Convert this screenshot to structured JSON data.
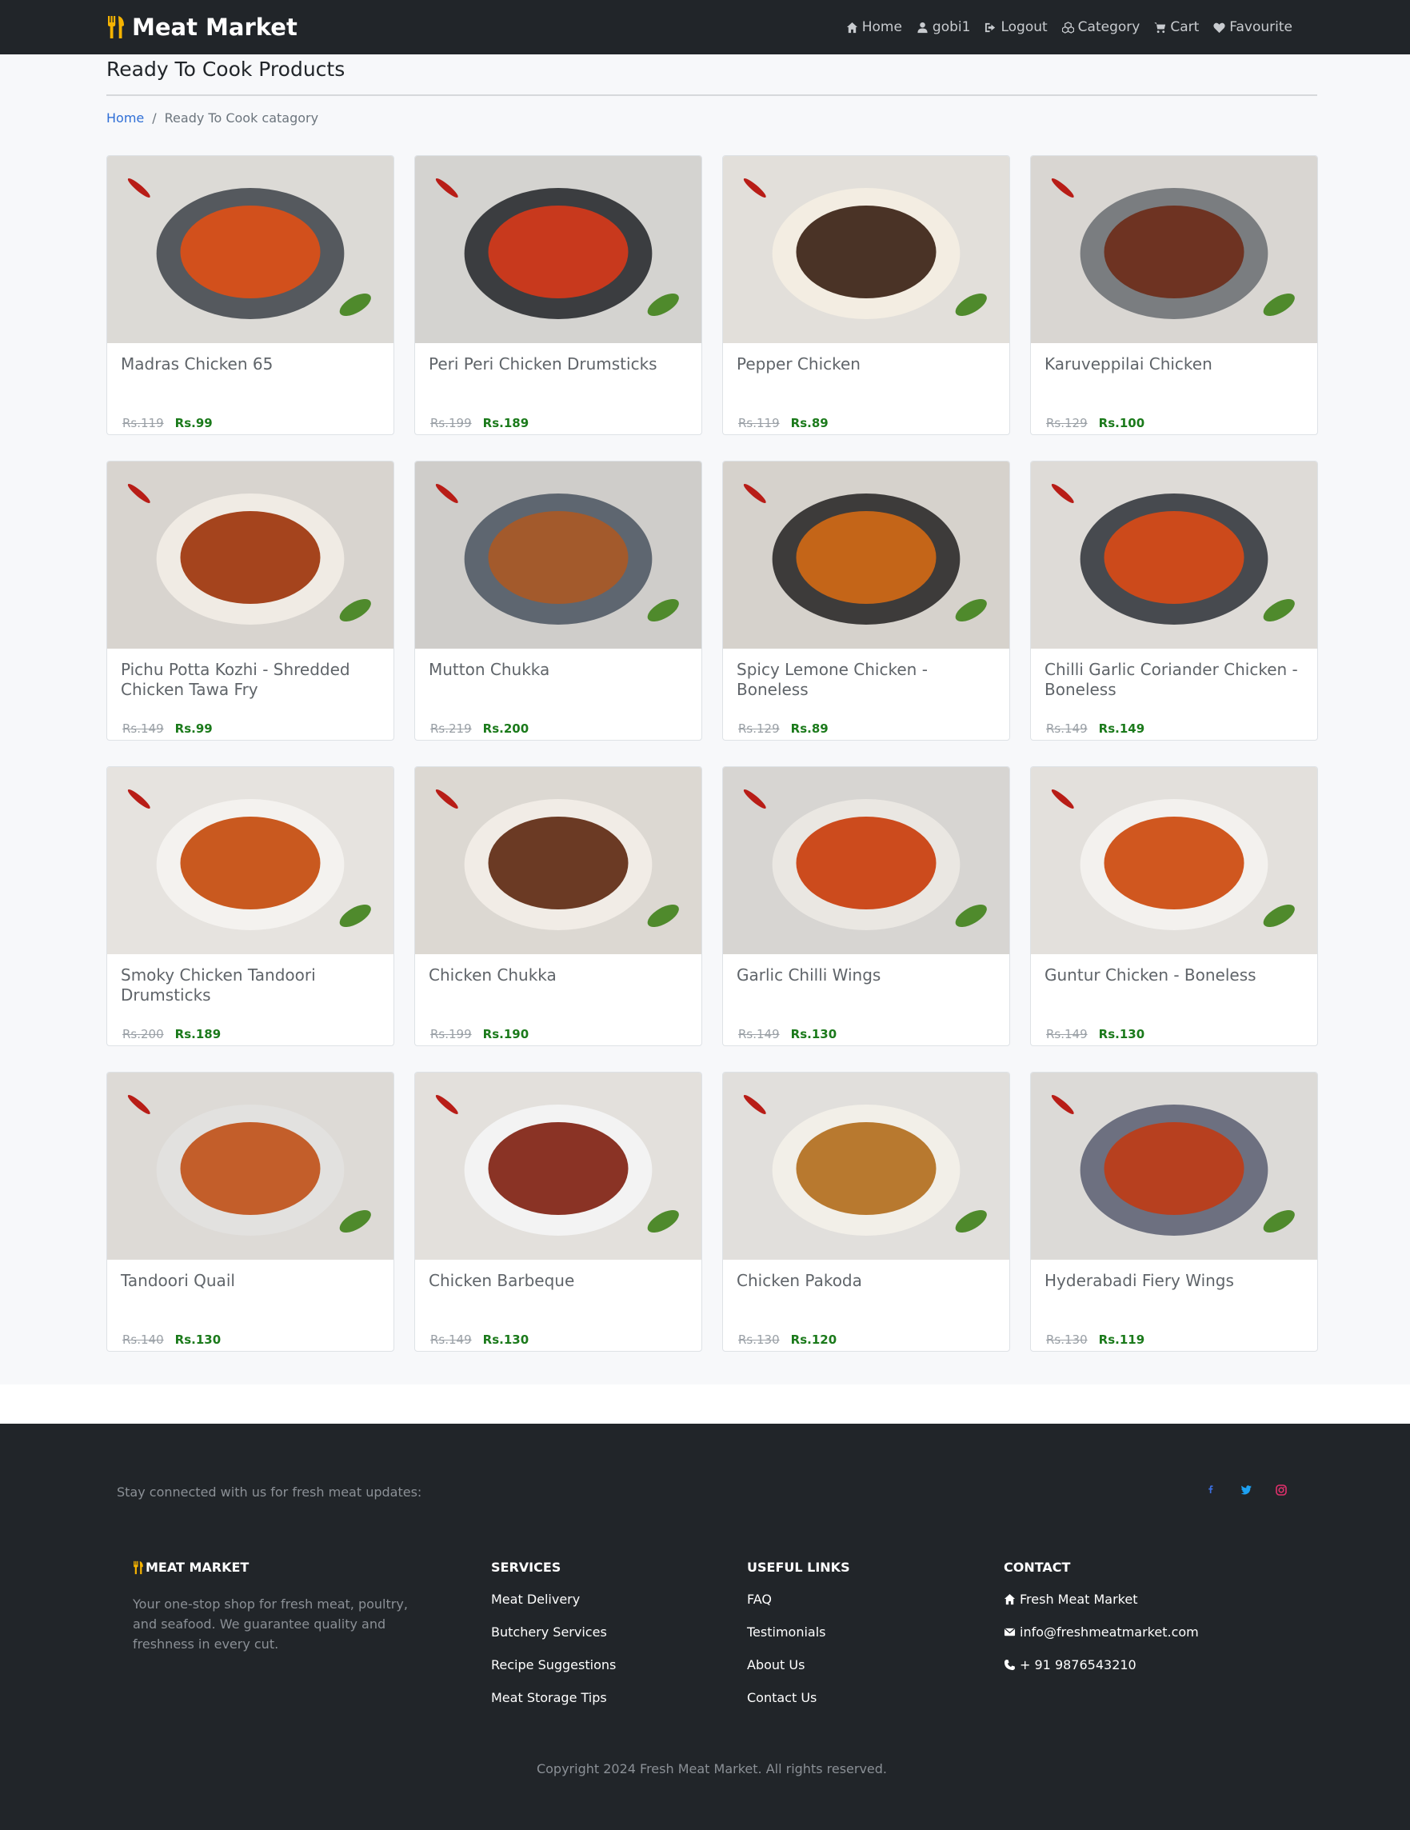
{
  "nav": {
    "brand": "Meat Market",
    "links": [
      "Home",
      "gobi1",
      "Logout",
      "Category",
      "Cart",
      "Favourite"
    ]
  },
  "page": {
    "title": "Ready To Cook Products",
    "breadcrumb": {
      "home": "Home",
      "separator": "/",
      "current": "Ready To Cook catagory"
    }
  },
  "products": [
    {
      "name": "Madras Chicken 65",
      "old_price": "Rs.119",
      "price": "Rs.99"
    },
    {
      "name": "Peri Peri Chicken Drumsticks",
      "old_price": "Rs.199",
      "price": "Rs.189"
    },
    {
      "name": "Pepper Chicken",
      "old_price": "Rs.119",
      "price": "Rs.89"
    },
    {
      "name": "Karuveppilai Chicken",
      "old_price": "Rs.129",
      "price": "Rs.100"
    },
    {
      "name": "Pichu Potta Kozhi - Shredded Chicken Tawa Fry",
      "old_price": "Rs.149",
      "price": "Rs.99"
    },
    {
      "name": "Mutton Chukka",
      "old_price": "Rs.219",
      "price": "Rs.200"
    },
    {
      "name": "Spicy Lemone Chicken - Boneless",
      "old_price": "Rs.129",
      "price": "Rs.89"
    },
    {
      "name": "Chilli Garlic Coriander Chicken - Boneless",
      "old_price": "Rs.149",
      "price": "Rs.149"
    },
    {
      "name": "Smoky Chicken Tandoori Drumsticks",
      "old_price": "Rs.200",
      "price": "Rs.189"
    },
    {
      "name": "Chicken Chukka",
      "old_price": "Rs.199",
      "price": "Rs.190"
    },
    {
      "name": "Garlic Chilli Wings",
      "old_price": "Rs.149",
      "price": "Rs.130"
    },
    {
      "name": "Guntur Chicken - Boneless",
      "old_price": "Rs.149",
      "price": "Rs.130"
    },
    {
      "name": "Tandoori Quail",
      "old_price": "Rs.140",
      "price": "Rs.130"
    },
    {
      "name": "Chicken Barbeque",
      "old_price": "Rs.149",
      "price": "Rs.130"
    },
    {
      "name": "Chicken Pakoda",
      "old_price": "Rs.130",
      "price": "Rs.120"
    },
    {
      "name": "Hyderabadi Fiery Wings",
      "old_price": "Rs.130",
      "price": "Rs.119"
    }
  ],
  "footer": {
    "stay_connected": "Stay connected with us for fresh meat updates:",
    "brand": "MEAT MARKET",
    "description": "Your one-stop shop for fresh meat, poultry, and seafood. We guarantee quality and freshness in every cut.",
    "services": {
      "heading": "SERVICES",
      "items": [
        "Meat Delivery",
        "Butchery Services",
        "Recipe Suggestions",
        "Meat Storage Tips"
      ]
    },
    "useful_links": {
      "heading": "USEFUL LINKS",
      "items": [
        "FAQ",
        "Testimonials",
        "About Us",
        "Contact Us"
      ]
    },
    "contact": {
      "heading": "CONTACT",
      "items": [
        "Fresh Meat Market",
        "info@freshmeatmarket.com",
        "+ 91 9876543210"
      ]
    },
    "copyright": "Copyright 2024 Fresh Meat Market. All rights reserved."
  },
  "colors": {
    "navbar": "#212529",
    "accent_link": "#2f6fd6",
    "price_green": "#1b7a1b",
    "brand_icon": "#f5b301"
  }
}
